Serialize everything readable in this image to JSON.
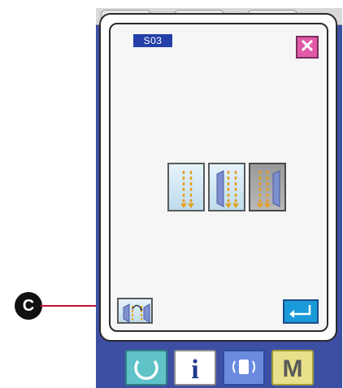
{
  "screen": {
    "code": "S03"
  },
  "buttons": {
    "close": {
      "icon": "close-icon",
      "color": "#e05aa8"
    },
    "modes": [
      {
        "icon": "single-row-stitch-icon",
        "selected": false
      },
      {
        "icon": "stitch-with-fabric-icon",
        "selected": false
      },
      {
        "icon": "double-row-stitch-icon",
        "selected": true
      }
    ],
    "flip": {
      "icon": "flip-pattern-icon"
    },
    "enter": {
      "icon": "enter-icon",
      "color": "#1a9ad8"
    }
  },
  "bottom_bar": {
    "ready": {
      "icon": "ready-icon",
      "color": "#5fc3c8"
    },
    "info": {
      "label": "i",
      "color": "#ffffff"
    },
    "communication": {
      "icon": "communication-icon",
      "color": "#6a8ae0"
    },
    "mode": {
      "label": "M",
      "color": "#e8e08a"
    }
  },
  "callout": {
    "label": "C",
    "color": "#c8102e"
  }
}
